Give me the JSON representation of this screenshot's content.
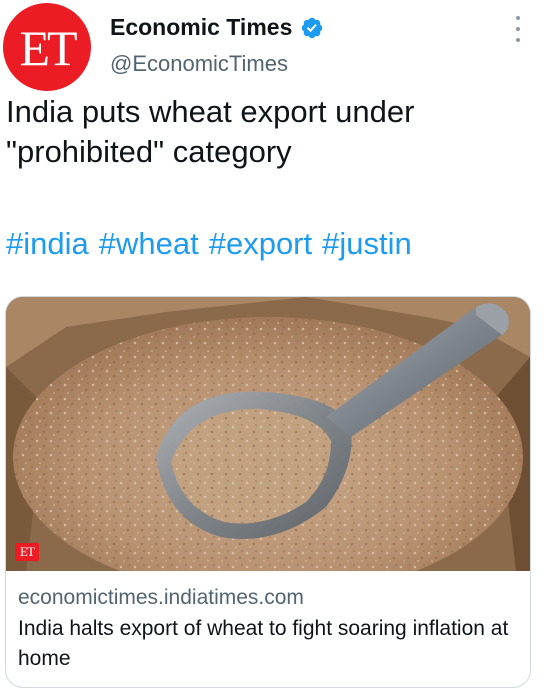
{
  "account": {
    "avatar_text": "ET",
    "name": "Economic Times",
    "handle": "@EconomicTimes",
    "verified": true
  },
  "tweet": {
    "text": "India puts wheat export under \"prohibited\" category",
    "hashtags": [
      "#india",
      "#wheat",
      "#export",
      "#justin"
    ]
  },
  "card": {
    "image_description": "wheat-bran-with-metal-scoop",
    "image_badge": "ET",
    "domain": "economictimes.indiatimes.com",
    "title": "India halts export of wheat to fight soaring inflation at home"
  },
  "icons": {
    "verified": "verified-badge-icon",
    "more": "more-options-icon"
  },
  "colors": {
    "brand_red": "#ec1c24",
    "link_blue": "#1d9bf0",
    "verified_blue": "#1d9bf0",
    "secondary_text": "#536471"
  }
}
